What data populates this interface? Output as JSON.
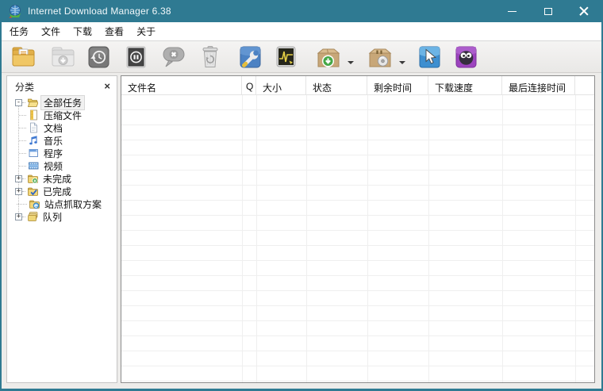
{
  "window": {
    "title": "Internet Download Manager 6.38"
  },
  "menu": {
    "items": [
      {
        "label": "任务"
      },
      {
        "label": "文件"
      },
      {
        "label": "下载"
      },
      {
        "label": "查看"
      },
      {
        "label": "关于"
      }
    ]
  },
  "toolbar": {
    "buttons": [
      {
        "name": "add-url",
        "icon": "folder-add-url-icon",
        "enabled": true
      },
      {
        "name": "resume",
        "icon": "folder-resume-icon",
        "enabled": false
      },
      {
        "name": "restart",
        "icon": "restart-clock-icon",
        "enabled": true
      },
      {
        "name": "stop",
        "icon": "stop-pause-icon",
        "enabled": true
      },
      {
        "name": "stop-all",
        "icon": "balloon-x-icon",
        "enabled": true
      },
      {
        "name": "delete-all-completed",
        "icon": "trash-recycle-icon",
        "enabled": true
      },
      {
        "name": "options",
        "icon": "wrench-icon",
        "enabled": true
      },
      {
        "name": "scheduler",
        "icon": "waveform-monitor-icon",
        "enabled": true
      },
      {
        "name": "start-queue",
        "icon": "box-download-icon",
        "enabled": true,
        "has_dropdown": true
      },
      {
        "name": "stop-queue",
        "icon": "box-disc-icon",
        "enabled": true,
        "has_dropdown": true
      },
      {
        "name": "grabber",
        "icon": "cursor-arrow-icon",
        "enabled": true
      },
      {
        "name": "tella",
        "icon": "tella-mascot-icon",
        "enabled": true
      }
    ]
  },
  "sidebar": {
    "title": "分类",
    "tree": [
      {
        "label": "全部任务",
        "depth": 0,
        "expand": "-",
        "icon": "open-folder-icon",
        "selected": true
      },
      {
        "label": "压缩文件",
        "depth": 1,
        "icon": "zip-file-icon"
      },
      {
        "label": "文档",
        "depth": 1,
        "icon": "document-icon"
      },
      {
        "label": "音乐",
        "depth": 1,
        "icon": "music-note-icon"
      },
      {
        "label": "程序",
        "depth": 1,
        "icon": "program-window-icon"
      },
      {
        "label": "视频",
        "depth": 1,
        "icon": "video-film-icon"
      },
      {
        "label": "未完成",
        "depth": 0,
        "expand": "+",
        "icon": "folder-download-icon"
      },
      {
        "label": "已完成",
        "depth": 0,
        "expand": "+",
        "icon": "folder-check-icon"
      },
      {
        "label": "站点抓取方案",
        "depth": 0,
        "icon": "folder-ie-icon"
      },
      {
        "label": "队列",
        "depth": 0,
        "expand": "+",
        "icon": "stacked-folders-icon"
      }
    ]
  },
  "table": {
    "columns": [
      {
        "label": "文件名"
      },
      {
        "label": "Q"
      },
      {
        "label": "大小"
      },
      {
        "label": "状态"
      },
      {
        "label": "剩余时间"
      },
      {
        "label": "下载速度"
      },
      {
        "label": "最后连接时间"
      }
    ],
    "rows": []
  },
  "colors": {
    "titlebar": "#2F7A92",
    "accent_green": "#45A847",
    "accent_blue": "#4C82C3",
    "accent_purple": "#9C44BE"
  }
}
